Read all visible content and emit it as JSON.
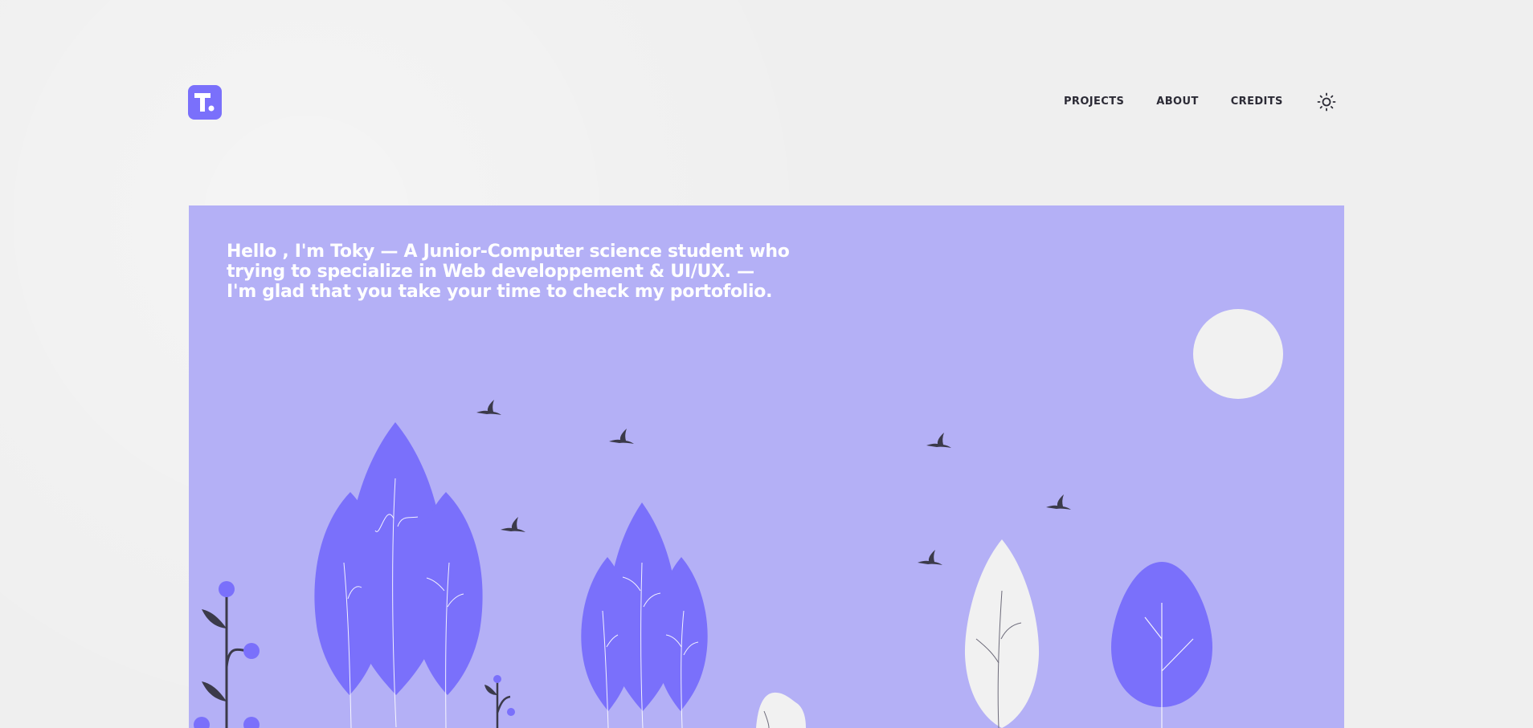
{
  "header": {
    "logo_icon": "t-letter-logo-icon",
    "logo_color": "#7a70fb",
    "nav": [
      {
        "label": "PROJECTS"
      },
      {
        "label": "ABOUT"
      },
      {
        "label": "CREDITS"
      }
    ],
    "theme_toggle_icon": "sun-icon"
  },
  "hero": {
    "background": "#b4b0f6",
    "intro_lines": [
      "Hello , I'm Toky — A Junior-Computer science student who",
      "trying to specialize in Web developpement & UI/UX. —",
      "I'm glad that you take your time to check my portofolio."
    ],
    "illustration": {
      "icons": [
        "moon-icon",
        "bird-icon",
        "tree-icon",
        "plant-icon",
        "rock-icon"
      ],
      "colors": {
        "tree": "#7a70fb",
        "pale_tree": "#f1f1f1",
        "bird": "#3b3a4a",
        "moon": "#f1f1f1"
      }
    }
  }
}
